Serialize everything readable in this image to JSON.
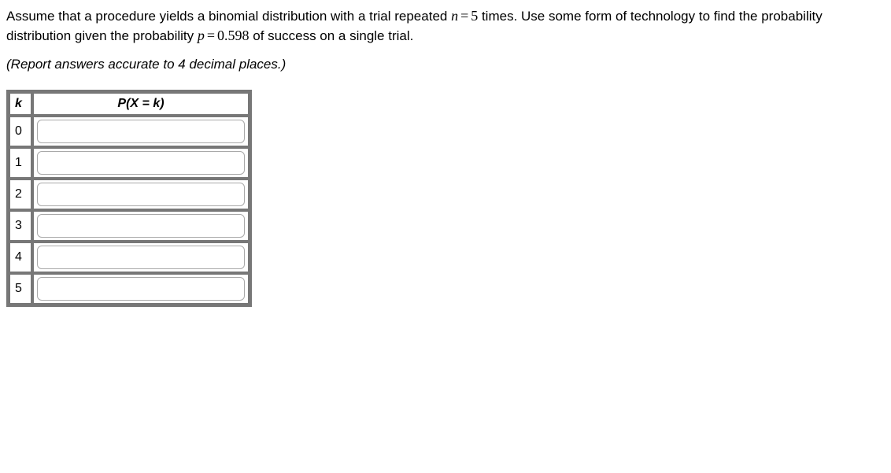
{
  "question": {
    "part1": "Assume that a procedure yields a binomial distribution with a trial repeated ",
    "nvar": "n",
    "eq1": "=",
    "nval": "5",
    "part2": " times. Use some form of technology to find the probability distribution given the probability ",
    "pvar": "p",
    "eq2": "=",
    "pval": "0.598",
    "part3": " of success on a single trial."
  },
  "instruction": "(Report answers accurate to 4 decimal places.)",
  "table": {
    "headers": {
      "k": "k",
      "p": "P(X = k)"
    },
    "rows": [
      {
        "k": "0",
        "value": ""
      },
      {
        "k": "1",
        "value": ""
      },
      {
        "k": "2",
        "value": ""
      },
      {
        "k": "3",
        "value": ""
      },
      {
        "k": "4",
        "value": ""
      },
      {
        "k": "5",
        "value": ""
      }
    ]
  }
}
